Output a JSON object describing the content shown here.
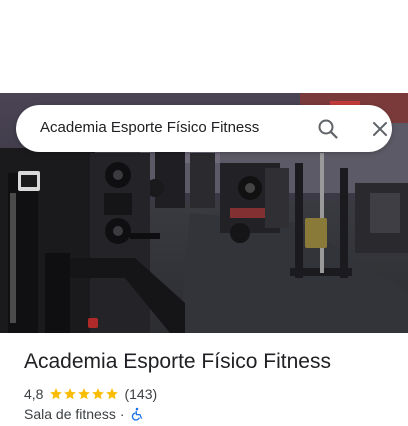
{
  "search": {
    "query": "Academia Esporte Físico Fitness"
  },
  "place": {
    "name": "Academia Esporte Físico Fitness",
    "rating_value": "4,8",
    "rating_stars": 5,
    "review_count": "(143)",
    "category": "Sala de fitness",
    "separator": "·"
  },
  "icons": {
    "search": "search-icon",
    "close": "close-icon",
    "star": "star-icon",
    "accessibility": "wheelchair-accessible-icon"
  },
  "colors": {
    "star": "#fbbc04",
    "accessible": "#1a73e8",
    "text_primary": "#202124",
    "text_secondary": "#3c4043"
  }
}
